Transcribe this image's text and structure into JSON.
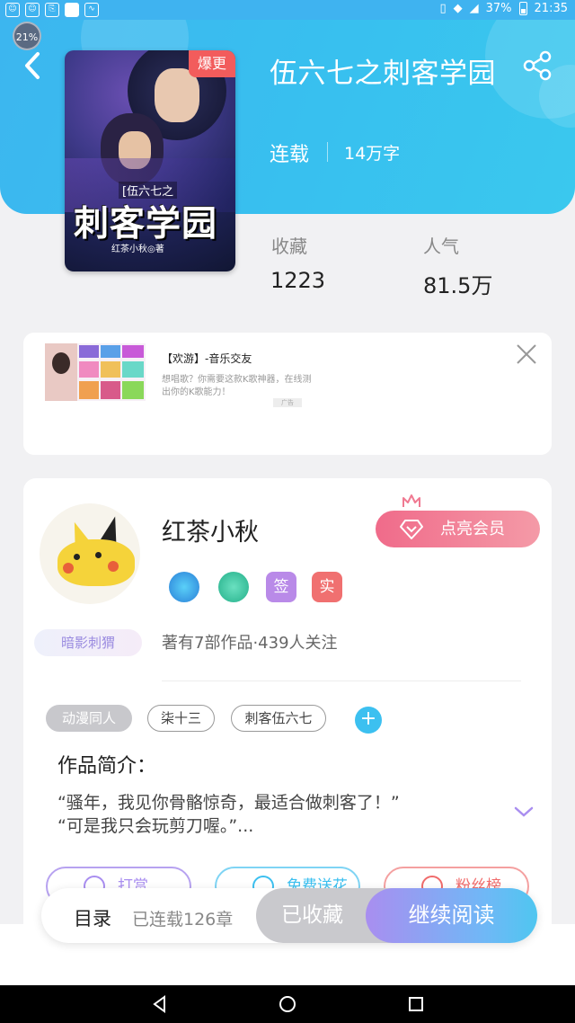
{
  "status_bar": {
    "battery": "37%",
    "time": "21:35"
  },
  "overlay": {
    "speed_badge": "21%"
  },
  "book": {
    "title": "伍六七之刺客学园",
    "status": "连载",
    "word_count": "14万字",
    "hot_tag": "爆更",
    "cover": {
      "subtitle": "[伍六七之",
      "title": "刺客学园",
      "author": "红茶小秋◎著"
    }
  },
  "stats": {
    "collect_label": "收藏",
    "collect_value": "1223",
    "popularity_label": "人气",
    "popularity_value": "81.5万"
  },
  "ad": {
    "title": "【欢游】-音乐交友",
    "description": "想唱歌？你需要这款K歌神器，在线测出你的K歌能力！",
    "mark": "广告"
  },
  "author": {
    "name": "红茶小秋",
    "badge": "暗影刺猬",
    "vip_button": "点亮会员",
    "honors": [
      "签",
      "实"
    ],
    "stats": "著有7部作品·439人关注"
  },
  "tags": [
    "动漫同人",
    "柒十三",
    "刺客伍六七"
  ],
  "intro": {
    "heading": "作品简介：",
    "lines": [
      "“骚年，我见你骨骼惊奇，最适合做刺客了！”",
      "“可是我只会玩剪刀喔。”..."
    ]
  },
  "actions": [
    "打赏",
    "免费送花",
    "粉丝榜"
  ],
  "bottom": {
    "toc": "目录",
    "progress": "已连载126章",
    "collected": "已收藏",
    "continue": "继续阅读"
  },
  "colors": {
    "primary": "#3cb6ef",
    "vip": "#f06b8a",
    "reward": "#a98ef0",
    "flower": "#3cc0f0",
    "fans": "#f06b6b"
  }
}
